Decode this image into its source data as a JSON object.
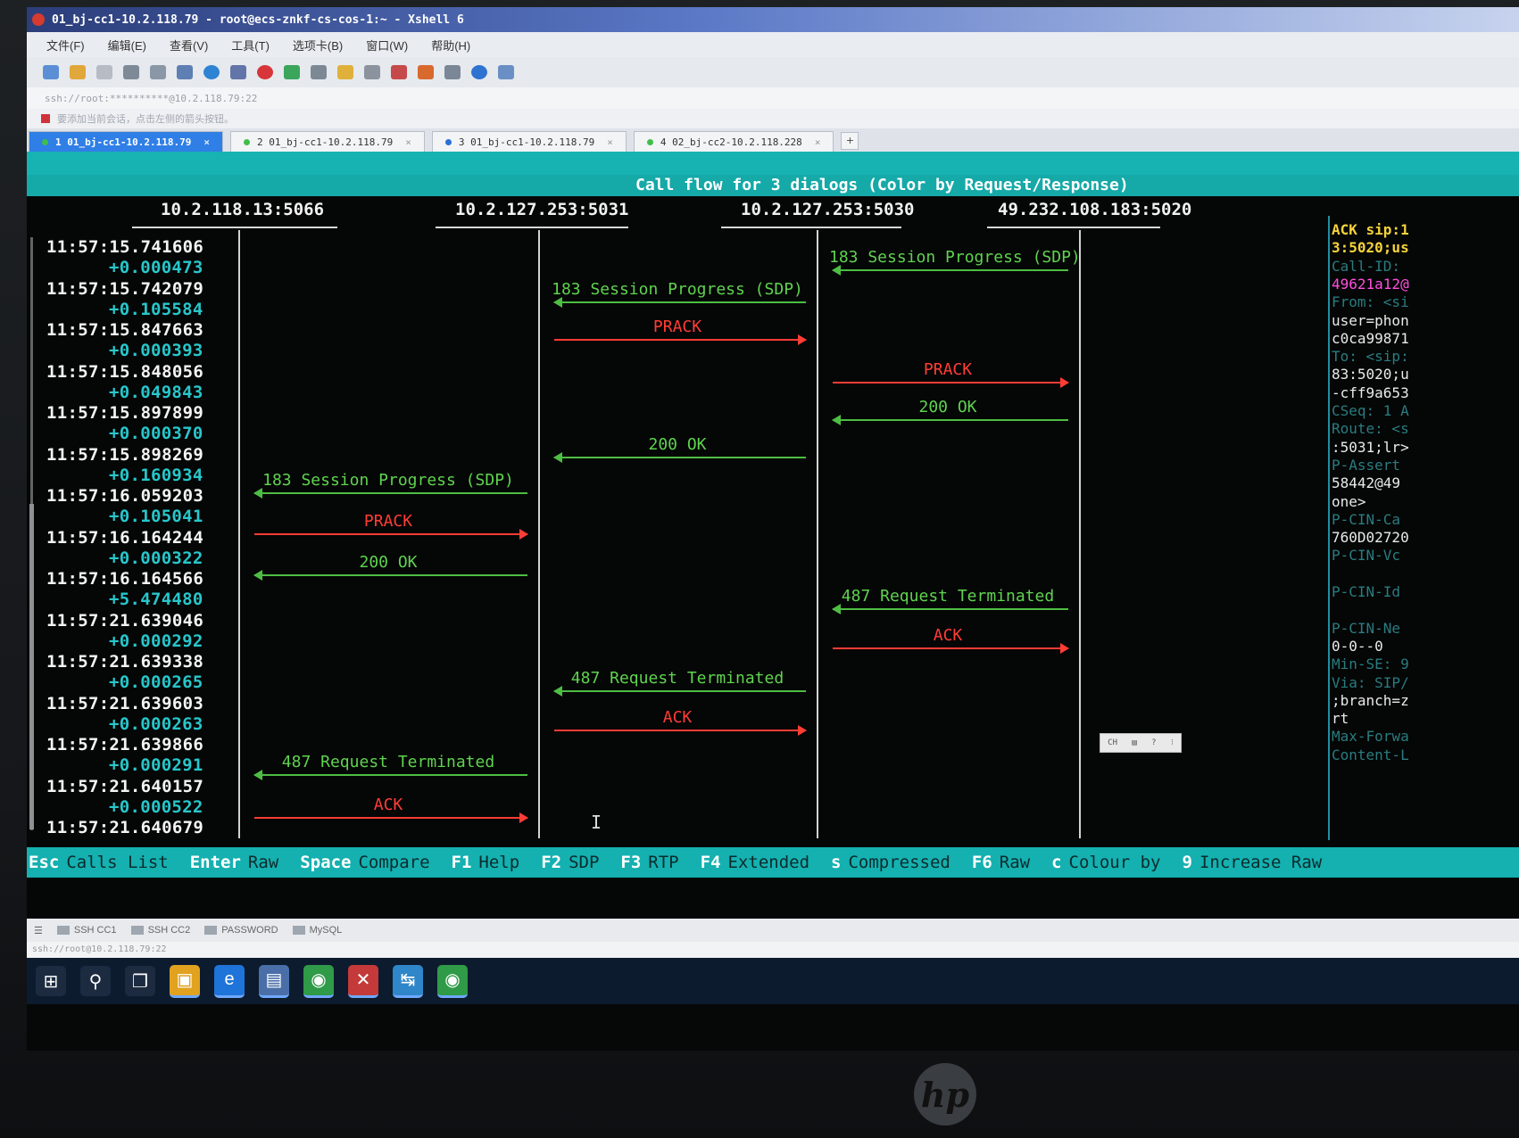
{
  "window": {
    "title": "01_bj-cc1-10.2.118.79 - root@ecs-znkf-cs-cos-1:~ - Xshell 6"
  },
  "menu": [
    "文件(F)",
    "编辑(E)",
    "查看(V)",
    "工具(T)",
    "选项卡(B)",
    "窗口(W)",
    "帮助(H)"
  ],
  "address": "ssh://root:**********@10.2.118.79:22",
  "hint": "要添加当前会话，点击左侧的箭头按钮。",
  "tabs": [
    {
      "label": "1 01_bj-cc1-10.2.118.79",
      "active": true
    },
    {
      "label": "2 01_bj-cc1-10.2.118.79",
      "active": false
    },
    {
      "label": "3 01_bj-cc1-10.2.118.79",
      "active": false
    },
    {
      "label": "4 02_bj-cc2-10.2.118.228",
      "active": false
    }
  ],
  "terminal": {
    "header": "Call flow for 3 dialogs (Color by Request/Response)",
    "hosts": [
      "10.2.118.13:5066",
      "10.2.127.253:5031",
      "10.2.127.253:5030",
      "49.232.108.183:5020"
    ],
    "timestamps": [
      {
        "abs": "11:57:15.741606",
        "delta": "+0.000473"
      },
      {
        "abs": "11:57:15.742079",
        "delta": "+0.105584"
      },
      {
        "abs": "11:57:15.847663",
        "delta": "+0.000393"
      },
      {
        "abs": "11:57:15.848056",
        "delta": "+0.049843"
      },
      {
        "abs": "11:57:15.897899",
        "delta": "+0.000370"
      },
      {
        "abs": "11:57:15.898269",
        "delta": "+0.160934"
      },
      {
        "abs": "11:57:16.059203",
        "delta": "+0.105041"
      },
      {
        "abs": "11:57:16.164244",
        "delta": "+0.000322"
      },
      {
        "abs": "11:57:16.164566",
        "delta": "+5.474480"
      },
      {
        "abs": "11:57:21.639046",
        "delta": "+0.000292"
      },
      {
        "abs": "11:57:21.639338",
        "delta": "+0.000265"
      },
      {
        "abs": "11:57:21.639603",
        "delta": "+0.000263"
      },
      {
        "abs": "11:57:21.639866",
        "delta": "+0.000291"
      },
      {
        "abs": "11:57:21.640157",
        "delta": "+0.000522"
      },
      {
        "abs": "11:57:21.640679",
        "delta": ""
      }
    ],
    "messages": [
      {
        "label": "183 Session Progress (SDP)",
        "kind": "response",
        "from": 3,
        "to": 2
      },
      {
        "label": "183 Session Progress (SDP)",
        "kind": "response",
        "from": 2,
        "to": 1
      },
      {
        "label": "PRACK",
        "kind": "request",
        "from": 1,
        "to": 2
      },
      {
        "label": "PRACK",
        "kind": "request",
        "from": 2,
        "to": 3
      },
      {
        "label": "200 OK",
        "kind": "response",
        "from": 3,
        "to": 2
      },
      {
        "label": "200 OK",
        "kind": "response",
        "from": 2,
        "to": 1
      },
      {
        "label": "183 Session Progress (SDP)",
        "kind": "response",
        "from": 1,
        "to": 0
      },
      {
        "label": "PRACK",
        "kind": "request",
        "from": 0,
        "to": 1
      },
      {
        "label": "200 OK",
        "kind": "response",
        "from": 1,
        "to": 0
      },
      {
        "label": "487 Request Terminated",
        "kind": "response",
        "from": 3,
        "to": 2
      },
      {
        "label": "ACK",
        "kind": "request",
        "from": 2,
        "to": 3
      },
      {
        "label": "487 Request Terminated",
        "kind": "response",
        "from": 2,
        "to": 1
      },
      {
        "label": "ACK",
        "kind": "request",
        "from": 1,
        "to": 2
      },
      {
        "label": "487 Request Terminated",
        "kind": "response",
        "from": 1,
        "to": 0
      },
      {
        "label": "ACK",
        "kind": "request",
        "from": 0,
        "to": 1
      }
    ],
    "side_panel": [
      {
        "text": "ACK sip:1",
        "style": "hl"
      },
      {
        "text": "3:5020;us",
        "style": "hl"
      },
      {
        "text": "Call-ID:",
        "style": "dim"
      },
      {
        "text": "49621a12@",
        "style": "pk"
      },
      {
        "text": "From: <si",
        "style": "dim"
      },
      {
        "text": "user=phon",
        "style": "wt"
      },
      {
        "text": "c0ca99871",
        "style": "wt"
      },
      {
        "text": "To: <sip:",
        "style": "dim"
      },
      {
        "text": "83:5020;u",
        "style": "wt"
      },
      {
        "text": "-cff9a653",
        "style": "wt"
      },
      {
        "text": "CSeq: 1 A",
        "style": "dim"
      },
      {
        "text": "Route: <s",
        "style": "dim"
      },
      {
        "text": ":5031;lr>",
        "style": "wt"
      },
      {
        "text": "P-Assert",
        "style": "dim"
      },
      {
        "text": "58442@49",
        "style": "wt"
      },
      {
        "text": "one>",
        "style": "wt"
      },
      {
        "text": "P-CIN-Ca",
        "style": "dim"
      },
      {
        "text": "760D02720",
        "style": "wt"
      },
      {
        "text": "P-CIN-Vc",
        "style": "dim"
      },
      {
        "text": "",
        "style": "dim"
      },
      {
        "text": "P-CIN-Id",
        "style": "dim"
      },
      {
        "text": "",
        "style": "dim"
      },
      {
        "text": "P-CIN-Ne",
        "style": "dim"
      },
      {
        "text": "0-0--0",
        "style": "wt"
      },
      {
        "text": "Min-SE: 9",
        "style": "dim"
      },
      {
        "text": "Via: SIP/",
        "style": "dim"
      },
      {
        "text": ";branch=z",
        "style": "wt"
      },
      {
        "text": "rt",
        "style": "wt"
      },
      {
        "text": "Max-Forwa",
        "style": "dim"
      },
      {
        "text": "Content-L",
        "style": "dim"
      }
    ],
    "ime": [
      "CH",
      "▤",
      "?",
      "⁝"
    ],
    "fkeys": [
      {
        "key": "Esc",
        "label": "Calls List"
      },
      {
        "key": "Enter",
        "label": "Raw"
      },
      {
        "key": "Space",
        "label": "Compare"
      },
      {
        "key": "F1",
        "label": "Help"
      },
      {
        "key": "F2",
        "label": "SDP"
      },
      {
        "key": "F3",
        "label": "RTP"
      },
      {
        "key": "F4",
        "label": "Extended"
      },
      {
        "key": "s",
        "label": "Compressed"
      },
      {
        "key": "F6",
        "label": "Raw"
      },
      {
        "key": "c",
        "label": "Colour by"
      },
      {
        "key": "9",
        "label": "Increase Raw"
      }
    ]
  },
  "sessions": [
    "SSH CC1",
    "SSH CC2",
    "PASSWORD",
    "MySQL"
  ],
  "status": "ssh://root@10.2.118.79:22",
  "taskbar": [
    {
      "name": "start-icon",
      "glyph": "⊞"
    },
    {
      "name": "search-icon",
      "glyph": "⚲"
    },
    {
      "name": "task-view-icon",
      "glyph": "❐"
    },
    {
      "name": "file-explorer-icon",
      "glyph": "▣"
    },
    {
      "name": "ie-icon",
      "glyph": "e"
    },
    {
      "name": "notepad-icon",
      "glyph": "▤"
    },
    {
      "name": "chrome-icon",
      "glyph": "◉"
    },
    {
      "name": "xshell-icon",
      "glyph": "✕"
    },
    {
      "name": "xftp-icon",
      "glyph": "↹"
    },
    {
      "name": "chrome-alt-icon",
      "glyph": "◉"
    }
  ],
  "brand_logo": "hp",
  "colors": {
    "cyan_bar": "#15b0b0",
    "response": "#5fd34f",
    "request": "#ff3d35",
    "timestamp": "#f4f4f4",
    "delta": "#27c7cb"
  }
}
